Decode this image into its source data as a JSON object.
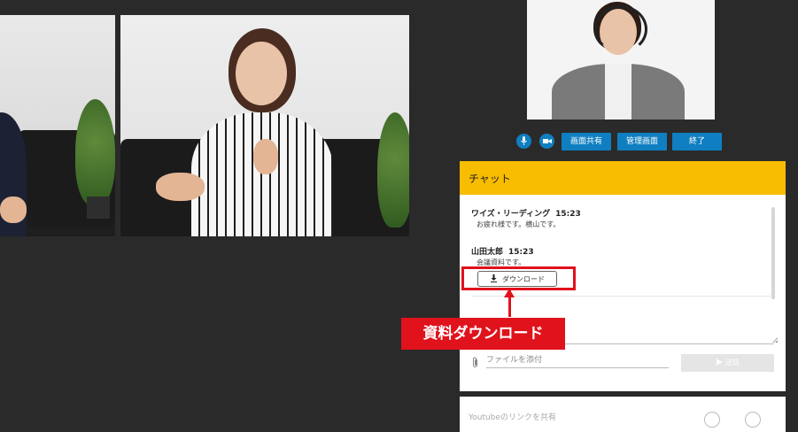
{
  "controls": {
    "mic_icon": "mic-icon",
    "camera_icon": "camera-icon",
    "share_screen": "画面共有",
    "manage_screen": "管理画面",
    "end": "終了"
  },
  "chat": {
    "title": "チャット",
    "messages": [
      {
        "name": "ワイズ・リーディング",
        "time": "15:23",
        "text": "お疲れ様です。横山です。"
      },
      {
        "name": "山田太郎",
        "time": "15:23",
        "text": "会議資料です。"
      }
    ],
    "download_label": "ダウンロード",
    "file_placeholder": "ファイルを添付",
    "send_label": "送信"
  },
  "callout": {
    "label": "資料ダウンロード"
  },
  "youtube": {
    "label": "Youtubeのリンクを共有"
  },
  "colors": {
    "accent": "#0f7fc1",
    "chat_header": "#f8bc00",
    "callout": "#e0121c",
    "background": "#2a2a2a"
  }
}
